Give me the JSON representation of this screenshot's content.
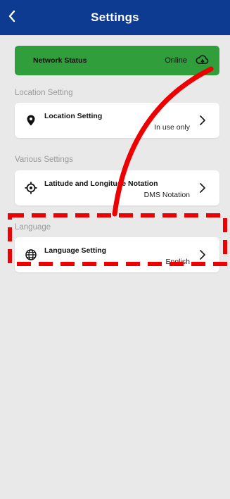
{
  "header": {
    "title": "Settings"
  },
  "network": {
    "label": "Network Status",
    "value": "Online"
  },
  "sections": {
    "location": {
      "title": "Location Setting",
      "item_label": "Location Setting",
      "item_value": "In use only"
    },
    "various": {
      "title": "Various Settings",
      "item_label": "Latitude and Longitude Notation",
      "item_value": "DMS Notation"
    },
    "language": {
      "title": "Language",
      "item_label": "Language Setting",
      "item_value": "English"
    }
  },
  "colors": {
    "header_bg": "#0d3b91",
    "network_bg": "#2f9e3b",
    "annotation": "#ee0000",
    "page_bg": "#e9e9e9"
  }
}
